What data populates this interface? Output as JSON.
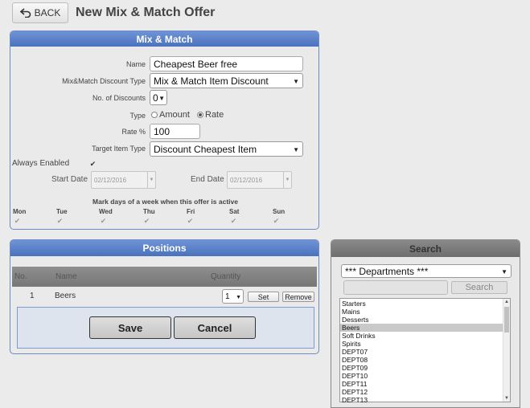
{
  "header": {
    "back_label": "BACK",
    "title": "New Mix & Match Offer"
  },
  "mix_match": {
    "heading": "Mix & Match",
    "name_label": "Name",
    "name_value": "Cheapest Beer free",
    "discount_type_label": "Mix&Match Discount Type",
    "discount_type_value": "Mix & Match Item Discount",
    "num_discounts_label": "No. of Discounts",
    "num_discounts_value": "0",
    "type_label": "Type",
    "type_amount": "Amount",
    "type_rate": "Rate",
    "type_selected": "Rate",
    "rate_label": "Rate %",
    "rate_value": "100",
    "target_type_label": "Target Item Type",
    "target_type_value": "Discount Cheapest Item",
    "always_enabled_label": "Always Enabled",
    "always_enabled_checked": true,
    "start_date_label": "Start Date",
    "start_date_value": "02/12/2016",
    "end_date_label": "End Date",
    "end_date_value": "02/12/2016",
    "days_heading": "Mark days of a week when this offer is active",
    "days": [
      "Mon",
      "Tue",
      "Wed",
      "Thu",
      "Fri",
      "Sat",
      "Sun"
    ]
  },
  "positions": {
    "heading": "Positions",
    "columns": {
      "no": "No.",
      "name": "Name",
      "quantity": "Quantity"
    },
    "rows": [
      {
        "no": "1",
        "name": "Beers",
        "quantity": "1"
      }
    ],
    "set_label": "Set",
    "remove_label": "Remove",
    "save_label": "Save",
    "cancel_label": "Cancel"
  },
  "search": {
    "heading": "Search",
    "dropdown_value": "*** Departments ***",
    "input_value": "",
    "button_label": "Search",
    "items": [
      "Starters",
      "Mains",
      "Desserts",
      "Beers",
      "Soft Drinks",
      "Spirits",
      "DEPT07",
      "DEPT08",
      "DEPT09",
      "DEPT10",
      "DEPT11",
      "DEPT12",
      "DEPT13"
    ],
    "selected_item": "Beers"
  }
}
